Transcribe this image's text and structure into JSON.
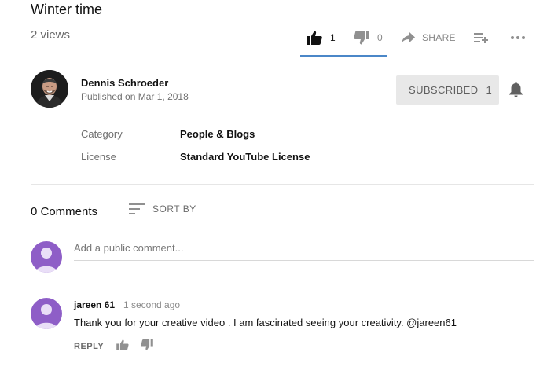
{
  "video": {
    "title": "Winter time",
    "views": "2 views",
    "likes": "1",
    "dislikes": "0",
    "share_label": "SHARE"
  },
  "channel": {
    "name": "Dennis Schroeder",
    "published": "Published on Mar 1, 2018",
    "subscribe_label": "SUBSCRIBED",
    "subscriber_count": "1"
  },
  "meta": {
    "category_label": "Category",
    "category_value": "People & Blogs",
    "license_label": "License",
    "license_value": "Standard YouTube License"
  },
  "comments": {
    "count_label": "0 Comments",
    "sort_label": "SORT BY",
    "input_placeholder": "Add a public comment...",
    "items": [
      {
        "author": "jareen 61",
        "time": "1 second ago",
        "text": "Thank you for your creative video . I am fascinated seeing your creativity. @jareen61",
        "reply_label": "REPLY"
      }
    ]
  },
  "colors": {
    "accent": "#4b87c8",
    "avatar_purple": "#8e5ec7",
    "subscribed_bg": "#e8e8e8"
  },
  "icons": [
    "thumb-up-icon",
    "thumb-down-icon",
    "share-arrow-icon",
    "add-to-playlist-icon",
    "more-icon",
    "bell-icon",
    "sort-icon",
    "user-avatar-icon"
  ]
}
